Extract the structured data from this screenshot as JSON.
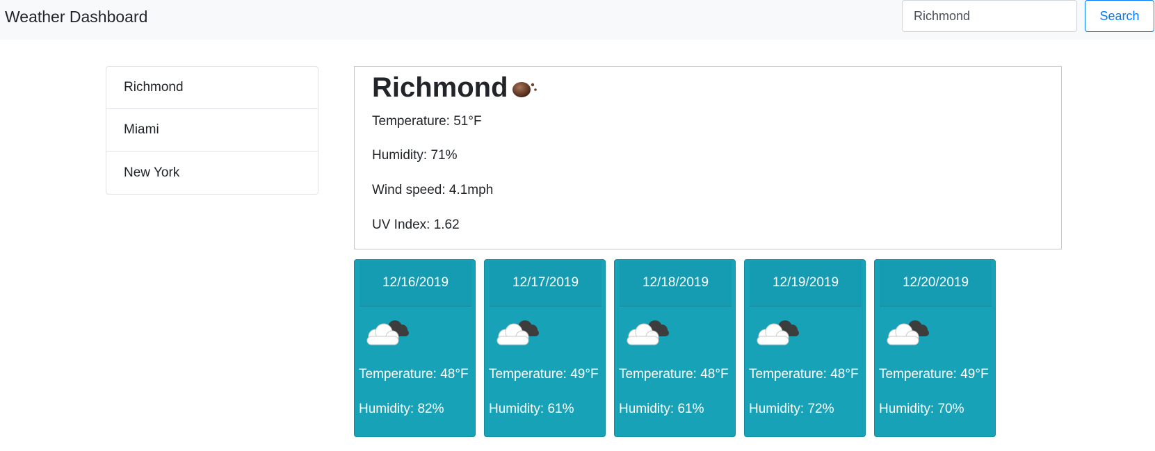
{
  "navbar": {
    "brand": "Weather Dashboard",
    "search": {
      "value": "Richmond"
    },
    "search_button": "Search"
  },
  "sidebar": {
    "cities": [
      "Richmond",
      "Miami",
      "New York"
    ]
  },
  "current": {
    "city": "Richmond",
    "icon": "night-cloud-icon",
    "temperature": "Temperature: 51°F",
    "humidity": "Humidity: 71%",
    "wind": "Wind speed: 4.1mph",
    "uv": "UV Index: 1.62"
  },
  "forecast": [
    {
      "date": "12/16/2019",
      "icon": "cloudy-icon",
      "temperature": "Temperature: 48°F",
      "humidity": "Humidity: 82%"
    },
    {
      "date": "12/17/2019",
      "icon": "cloudy-icon",
      "temperature": "Temperature: 49°F",
      "humidity": "Humidity: 61%"
    },
    {
      "date": "12/18/2019",
      "icon": "cloudy-icon",
      "temperature": "Temperature: 48°F",
      "humidity": "Humidity: 61%"
    },
    {
      "date": "12/19/2019",
      "icon": "cloudy-icon",
      "temperature": "Temperature: 48°F",
      "humidity": "Humidity: 72%"
    },
    {
      "date": "12/20/2019",
      "icon": "cloudy-icon",
      "temperature": "Temperature: 49°F",
      "humidity": "Humidity: 70%"
    }
  ],
  "colors": {
    "forecast_card": "#17a2b8",
    "accent": "#007bff",
    "navbar_bg": "#f8f9fa"
  }
}
